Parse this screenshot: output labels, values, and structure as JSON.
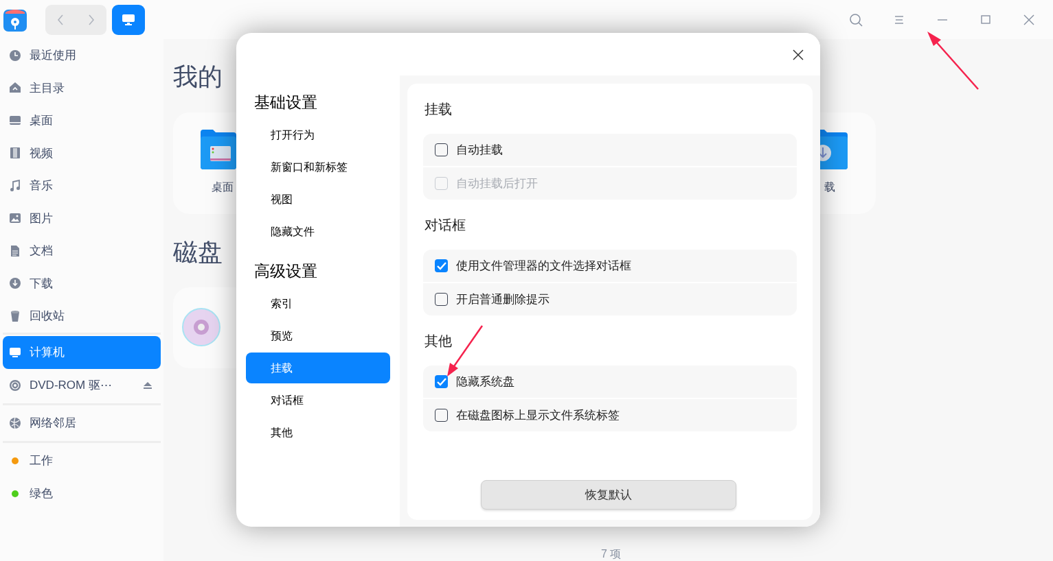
{
  "titlebar": {
    "nav": [
      {
        "kind": "back"
      },
      {
        "kind": "forward"
      }
    ],
    "view_button": {
      "selected": true
    },
    "controls": [
      {
        "kind": "search"
      },
      {
        "kind": "menu"
      },
      {
        "kind": "minimize"
      },
      {
        "kind": "maximize"
      },
      {
        "kind": "close"
      }
    ]
  },
  "sidebar": {
    "groups": [
      {
        "items": [
          {
            "label": "最近使用",
            "kind": "clock",
            "selected": false
          },
          {
            "label": "主目录",
            "kind": "home",
            "selected": false
          },
          {
            "label": "桌面",
            "kind": "desktop",
            "selected": false
          },
          {
            "label": "视频",
            "kind": "film",
            "selected": false
          },
          {
            "label": "音乐",
            "kind": "music",
            "selected": false
          },
          {
            "label": "图片",
            "kind": "image",
            "selected": false
          },
          {
            "label": "文档",
            "kind": "doc",
            "selected": false
          },
          {
            "label": "下载",
            "kind": "download",
            "selected": false
          },
          {
            "label": "回收站",
            "kind": "trash",
            "selected": false
          }
        ]
      },
      {
        "items": [
          {
            "label": "计算机",
            "kind": "computer",
            "selected": true
          },
          {
            "label": "DVD-ROM 驱⋯",
            "kind": "disc",
            "selected": false,
            "eject": true
          }
        ]
      },
      {
        "items": [
          {
            "label": "网络邻居",
            "kind": "network",
            "selected": false
          }
        ]
      },
      {
        "items": [
          {
            "label": "工作",
            "kind": "tag",
            "color": "#f59a0e",
            "selected": false
          },
          {
            "label": "绿色",
            "kind": "tag",
            "color": "#4fce1c",
            "selected": false
          }
        ]
      }
    ]
  },
  "main": {
    "sections": [
      {
        "title": "我的",
        "items": [
          {
            "label": "桌面",
            "kind": "desktop"
          },
          {
            "label": "载",
            "kind": "download"
          }
        ]
      },
      {
        "title": "磁盘",
        "items": [
          {
            "kind": "disc"
          }
        ]
      }
    ],
    "status": "7 项"
  },
  "dialog": {
    "nav": [
      {
        "title": "基础设置",
        "items": [
          {
            "label": "打开行为",
            "selected": false
          },
          {
            "label": "新窗口和新标签",
            "selected": false
          },
          {
            "label": "视图",
            "selected": false
          },
          {
            "label": "隐藏文件",
            "selected": false
          }
        ]
      },
      {
        "title": "高级设置",
        "items": [
          {
            "label": "索引",
            "selected": false
          },
          {
            "label": "预览",
            "selected": false
          },
          {
            "label": "挂载",
            "selected": true
          },
          {
            "label": "对话框",
            "selected": false
          },
          {
            "label": "其他",
            "selected": false
          }
        ]
      }
    ],
    "sections": [
      {
        "title": "挂载",
        "options": [
          {
            "label": "自动挂载",
            "checked": false,
            "disabled": false
          },
          {
            "label": "自动挂载后打开",
            "checked": false,
            "disabled": true
          }
        ]
      },
      {
        "title": "对话框",
        "options": [
          {
            "label": "使用文件管理器的文件选择对话框",
            "checked": true,
            "disabled": false
          },
          {
            "label": "开启普通删除提示",
            "checked": false,
            "disabled": false
          }
        ]
      },
      {
        "title": "其他",
        "options": [
          {
            "label": "隐藏系统盘",
            "checked": true,
            "disabled": false
          },
          {
            "label": "在磁盘图标上显示文件系统标签",
            "checked": false,
            "disabled": false
          }
        ]
      }
    ],
    "reset_button": "恢复默认"
  }
}
